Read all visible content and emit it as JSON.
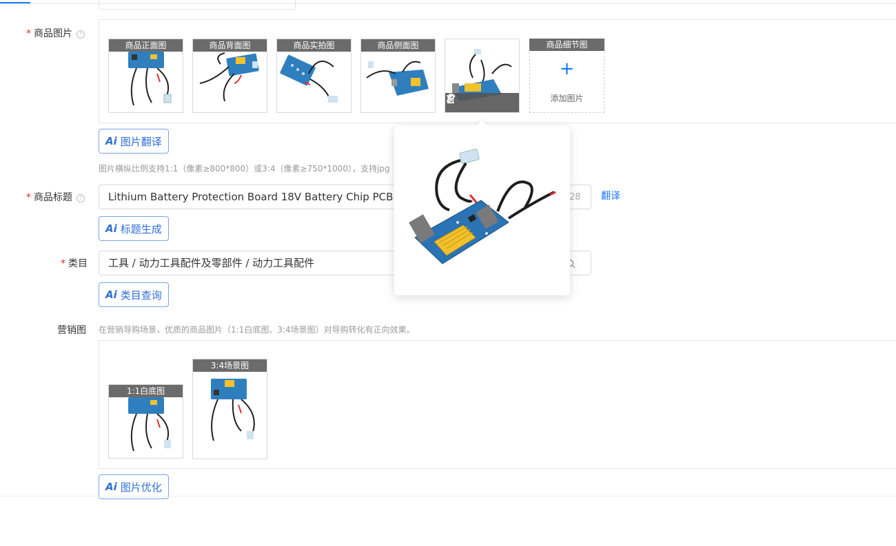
{
  "product_images": {
    "label": "商品图片",
    "help_icon": "question-circle-icon",
    "slots": [
      {
        "caption": "商品正面图"
      },
      {
        "caption": "商品背面图"
      },
      {
        "caption": "商品实拍图"
      },
      {
        "caption": "商品侧面图"
      },
      {
        "caption": ""
      }
    ],
    "add_slot": {
      "caption": "商品细节图",
      "plus": "+",
      "label": "添加图片"
    },
    "translate_button": "图片翻译",
    "hint": "图片横纵比例支持1:1（像素≥800*800）或3:4（像素≥750*1000），支持jpg"
  },
  "title_field": {
    "label": "商品标题",
    "value": "Lithium Battery Protection Board 18V Battery Chip PCB Board",
    "counter_tail": "28",
    "translate_link": "翻译",
    "generate_button": "标题生成"
  },
  "category_field": {
    "label": "类目",
    "value": "工具 / 动力工具配件及零部件 / 动力工具配件",
    "query_button": "类目查询"
  },
  "marketing": {
    "label": "营销图",
    "hint": "在营销导购场景，优质的商品图片（1:1白底图、3:4场景图）对导购转化有正向效果。",
    "slots": [
      {
        "caption": "1:1白底图"
      },
      {
        "caption": "3:4场景图"
      }
    ],
    "optimize_button": "图片优化"
  },
  "ai_logo": "Ai",
  "colors": {
    "accent": "#1677ff",
    "ai_blue": "#2f6fd6",
    "required": "#f5222d",
    "pcb_blue": "#2f7fbf",
    "chip_yellow": "#f2c12e"
  }
}
